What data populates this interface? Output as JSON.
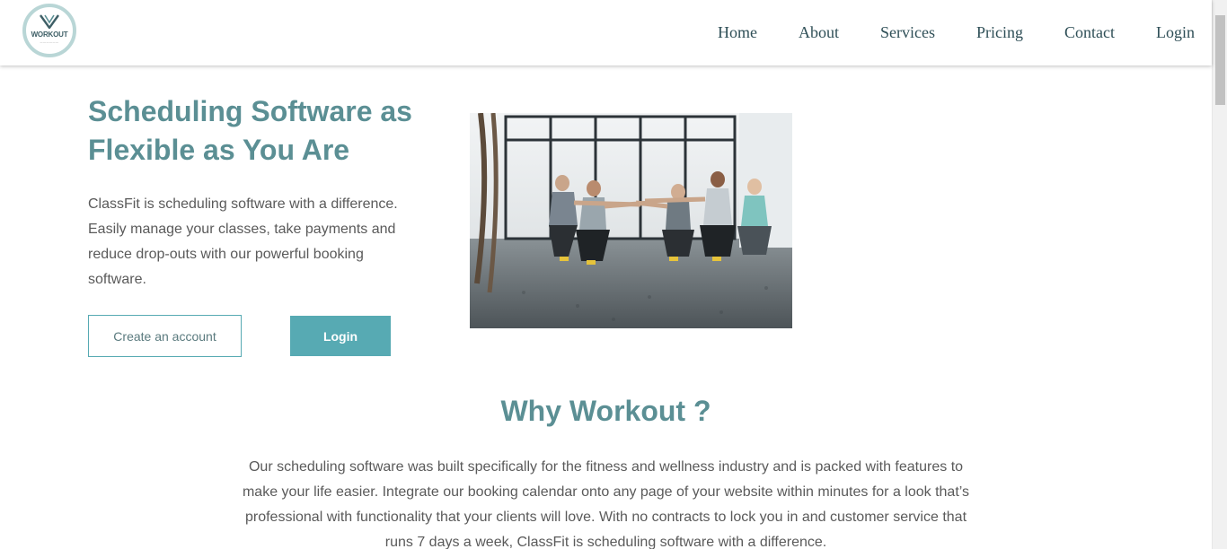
{
  "nav": {
    "logo_text": "WORKOUT",
    "items": [
      "Home",
      "About",
      "Services",
      "Pricing",
      "Contact",
      "Login"
    ]
  },
  "hero": {
    "title": "Scheduling Software as Flexible as You Are",
    "description": "ClassFit is scheduling software with a difference. Easily manage your classes, take payments and reduce drop-outs with our powerful booking software.",
    "create_account_label": "Create an account",
    "login_label": "Login"
  },
  "why": {
    "title": "Why Workout ?",
    "text": "Our scheduling software was built specifically for the fitness and wellness industry and is packed with features to make your life easier. Integrate our booking calendar onto any page of your website within minutes for a look that’s professional with functionality that your clients will love. With no contracts to lock you in and customer service that runs 7 days a week, ClassFit is scheduling software with a difference."
  },
  "colors": {
    "accent": "#57aab3",
    "heading": "#5b8f94",
    "nav_text": "#2f4f57",
    "body_text": "#5a5a5a"
  },
  "icons": {
    "logo": "workout-logo",
    "hero_image": "group-fitness-photo"
  }
}
